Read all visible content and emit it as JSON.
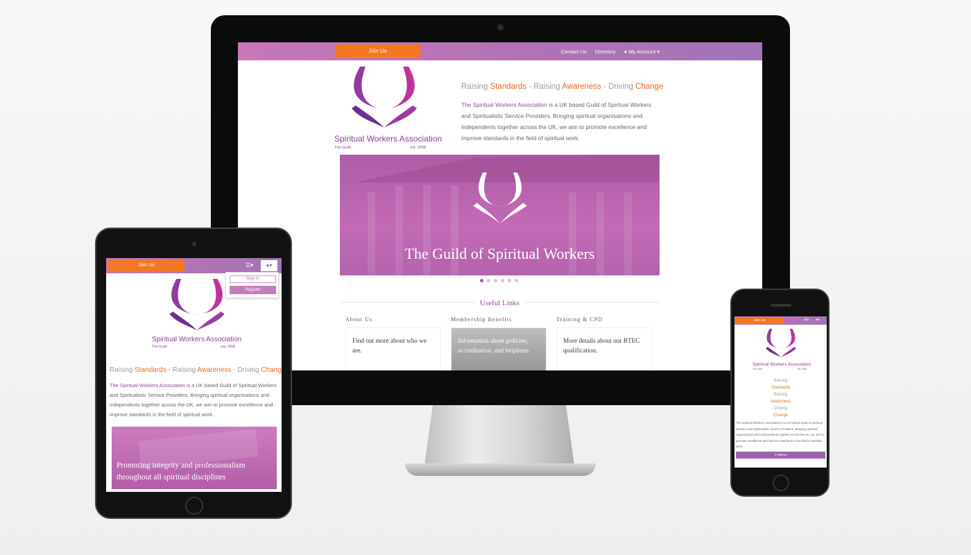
{
  "nav": {
    "join_label": "Join Us",
    "contact_label": "Contact Us",
    "directory_label": "Directory",
    "account_label": "My Account"
  },
  "logo": {
    "name": "Spiritual Workers Association",
    "sub": "The Guild",
    "est": "est. 2008"
  },
  "tagline": {
    "raising1": "Raising",
    "standards": "Standards",
    "sep1": "-",
    "raising2": "Raising",
    "awareness": "Awareness",
    "sep2": "-",
    "driving": "Driving",
    "change": "Change"
  },
  "intro": {
    "link": "The Spiritual Workers Association",
    "rest": " is a UK based Guild of Spiritual Workers and Spiritualistic Service Providers. Bringing spiritual organisations and independents together across the UK, we aim to promote excellence and improve standards in the field of spiritual work."
  },
  "desktop": {
    "hero_title": "The Guild of Spiritual Workers",
    "slider_count": 6,
    "slider_active": 1,
    "useful_links_title": "Useful Links",
    "cards": [
      {
        "heading": "About Us",
        "text": "Find out more about who we are."
      },
      {
        "heading": "Membership Benefits",
        "text": "Information about policies, accreditation, and helplines."
      },
      {
        "heading": "Training & CPD",
        "text": "More details about our BTEC qualification."
      }
    ]
  },
  "tablet": {
    "sign_in_label": "Sign In",
    "register_label": "Register",
    "hero_title": "Promoting integrity and professionalism throughout all spiritual disciplines"
  },
  "phone": {
    "menu_label": "MENU"
  },
  "colors": {
    "accent_orange": "#f47722",
    "brand_purple": "#8e3ca0",
    "nav_gradient_start": "#c877b8",
    "nav_gradient_end": "#a175b6"
  }
}
